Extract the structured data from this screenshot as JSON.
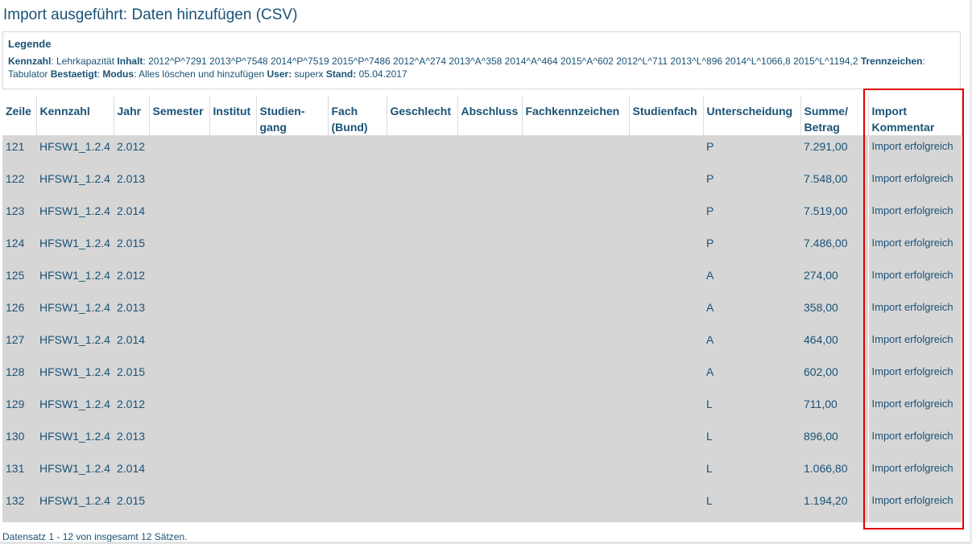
{
  "title": "Import ausgeführt: Daten hinzufügen (CSV)",
  "legend": {
    "heading": "Legende",
    "items": [
      {
        "key": "Kennzahl",
        "value": ": Lehrkapazität "
      },
      {
        "key": "Inhalt",
        "value": ": 2012^P^7291 2013^P^7548 2014^P^7519 2015^P^7486 2012^A^274 2013^A^358 2014^A^464 2015^A^602 2012^L^711 2013^L^896 2014^L^1066,8 2015^L^1194,2 "
      },
      {
        "key": "Trennzeichen",
        "value": ": Tabulator "
      },
      {
        "key": "Bestaetigt",
        "value": ":  "
      },
      {
        "key": "Modus",
        "value": ": Alles löschen und hinzufügen "
      },
      {
        "key": "User:",
        "value": " superx "
      },
      {
        "key": "Stand:",
        "value": " 05.04.2017"
      }
    ]
  },
  "table": {
    "columns": [
      "Zeile",
      "Kennzahl",
      "Jahr",
      "Semester",
      "Institut",
      "Studien-gang",
      "Fach (Bund)",
      "Geschlecht",
      "Abschluss",
      "Fachkennzeichen",
      "Studienfach",
      "Unterscheidung",
      "Summe/ Betrag",
      "Import Kommentar"
    ],
    "rows": [
      [
        "121",
        "HFSW1_1.2.4",
        "2.012",
        "",
        "",
        "",
        "",
        "",
        "",
        "",
        "",
        "P",
        "7.291,00",
        "Import erfolgreich"
      ],
      [
        "122",
        "HFSW1_1.2.4",
        "2.013",
        "",
        "",
        "",
        "",
        "",
        "",
        "",
        "",
        "P",
        "7.548,00",
        "Import erfolgreich"
      ],
      [
        "123",
        "HFSW1_1.2.4",
        "2.014",
        "",
        "",
        "",
        "",
        "",
        "",
        "",
        "",
        "P",
        "7.519,00",
        "Import erfolgreich"
      ],
      [
        "124",
        "HFSW1_1.2.4",
        "2.015",
        "",
        "",
        "",
        "",
        "",
        "",
        "",
        "",
        "P",
        "7.486,00",
        "Import erfolgreich"
      ],
      [
        "125",
        "HFSW1_1.2.4",
        "2.012",
        "",
        "",
        "",
        "",
        "",
        "",
        "",
        "",
        "A",
        "274,00",
        "Import erfolgreich"
      ],
      [
        "126",
        "HFSW1_1.2.4",
        "2.013",
        "",
        "",
        "",
        "",
        "",
        "",
        "",
        "",
        "A",
        "358,00",
        "Import erfolgreich"
      ],
      [
        "127",
        "HFSW1_1.2.4",
        "2.014",
        "",
        "",
        "",
        "",
        "",
        "",
        "",
        "",
        "A",
        "464,00",
        "Import erfolgreich"
      ],
      [
        "128",
        "HFSW1_1.2.4",
        "2.015",
        "",
        "",
        "",
        "",
        "",
        "",
        "",
        "",
        "A",
        "602,00",
        "Import erfolgreich"
      ],
      [
        "129",
        "HFSW1_1.2.4",
        "2.012",
        "",
        "",
        "",
        "",
        "",
        "",
        "",
        "",
        "L",
        "711,00",
        "Import erfolgreich"
      ],
      [
        "130",
        "HFSW1_1.2.4",
        "2.013",
        "",
        "",
        "",
        "",
        "",
        "",
        "",
        "",
        "L",
        "896,00",
        "Import erfolgreich"
      ],
      [
        "131",
        "HFSW1_1.2.4",
        "2.014",
        "",
        "",
        "",
        "",
        "",
        "",
        "",
        "",
        "L",
        "1.066,80",
        "Import erfolgreich"
      ],
      [
        "132",
        "HFSW1_1.2.4",
        "2.015",
        "",
        "",
        "",
        "",
        "",
        "",
        "",
        "",
        "L",
        "1.194,20",
        "Import erfolgreich"
      ]
    ]
  },
  "footer": "Datensatz 1 - 12 von insgesamt 12 Sätzen.",
  "colors": {
    "text": "#1a5276",
    "row_bg": "#d6d6d6",
    "highlight": "#e00000"
  }
}
